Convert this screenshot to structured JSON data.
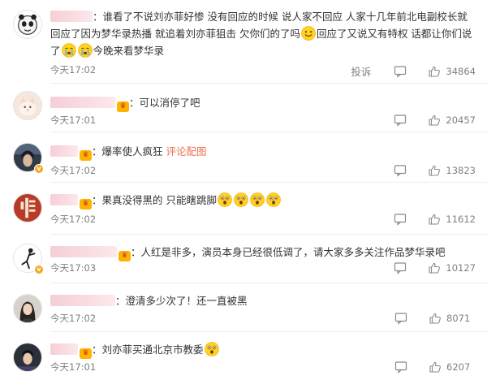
{
  "comments": [
    {
      "text_segments": [
        "：谁看了不说刘亦菲好惨 没有回应的时候 说人家不回应 人家十几年前北电副校长就回应了因为梦华录热播 就追着刘亦菲狙击 欠你们的了吗",
        "回应了又说又有特权 话都让你们说了",
        "今晚来看梦华录"
      ],
      "time": "今天17:02",
      "report": "投诉",
      "likes": "34864"
    },
    {
      "text": "：可以消停了吧",
      "time": "今天17:01",
      "likes": "20457"
    },
    {
      "text": "：爆率使人疯狂",
      "link": "评论配图",
      "time": "今天17:02",
      "likes": "13823"
    },
    {
      "text": "：果真没得黑的 只能瞎跳脚",
      "time": "今天17:02",
      "likes": "11612"
    },
    {
      "text": "：人红是非多，演员本身已经很低调了，请大家多多关注作品梦华录吧",
      "time": "今天17:03",
      "likes": "10127"
    },
    {
      "text": "：澄清多少次了！还一直被黑",
      "time": "今天17:02",
      "likes": "8071"
    },
    {
      "text": "：刘亦菲买通北京市教委",
      "time": "今天17:01",
      "likes": "6207"
    }
  ],
  "icons": {
    "reply": "comment-bubble-icon",
    "like": "thumbs-up-icon",
    "emoji_smile": "smile-emoji-icon",
    "emoji_cry": "crying-emoji-icon",
    "emoji_shock": "shocked-emoji-icon",
    "level_badge": "membership-level-icon",
    "verified": "verified-badge-icon"
  },
  "colors": {
    "link": "#eb7350",
    "meta_text": "#808080",
    "body_text": "#333333",
    "level_badge": "#ffb300"
  }
}
